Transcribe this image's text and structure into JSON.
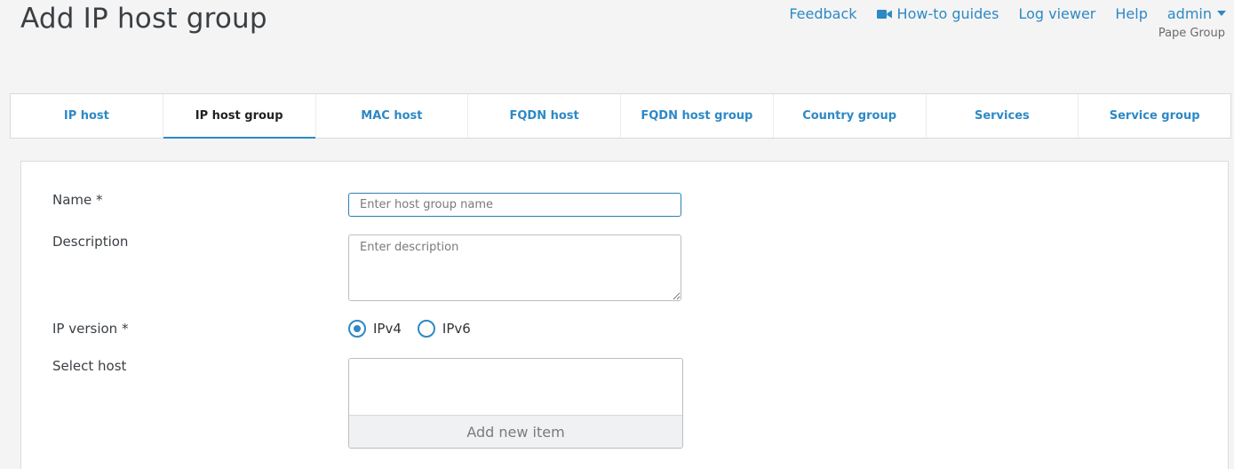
{
  "page": {
    "title": "Add IP host group"
  },
  "topnav": {
    "feedback": "Feedback",
    "howto": "How-to guides",
    "logviewer": "Log viewer",
    "help": "Help",
    "user": "admin",
    "org": "Pape Group",
    "icons": {
      "howto": "video-camera-icon",
      "user_menu": "caret-down-icon"
    },
    "link_color": "#2d89c5"
  },
  "tabs": [
    {
      "label": "IP host",
      "active": false
    },
    {
      "label": "IP host group",
      "active": true
    },
    {
      "label": "MAC host",
      "active": false
    },
    {
      "label": "FQDN host",
      "active": false
    },
    {
      "label": "FQDN host group",
      "active": false
    },
    {
      "label": "Country group",
      "active": false
    },
    {
      "label": "Services",
      "active": false
    },
    {
      "label": "Service group",
      "active": false
    }
  ],
  "form": {
    "name": {
      "label": "Name *",
      "placeholder": "Enter host group name",
      "value": ""
    },
    "description": {
      "label": "Description",
      "placeholder": "Enter description",
      "value": ""
    },
    "ip_version": {
      "label": "IP version *",
      "options": [
        {
          "label": "IPv4",
          "selected": true
        },
        {
          "label": "IPv6",
          "selected": false
        }
      ]
    },
    "select_host": {
      "label": "Select host",
      "items": [],
      "add_label": "Add new item"
    }
  }
}
